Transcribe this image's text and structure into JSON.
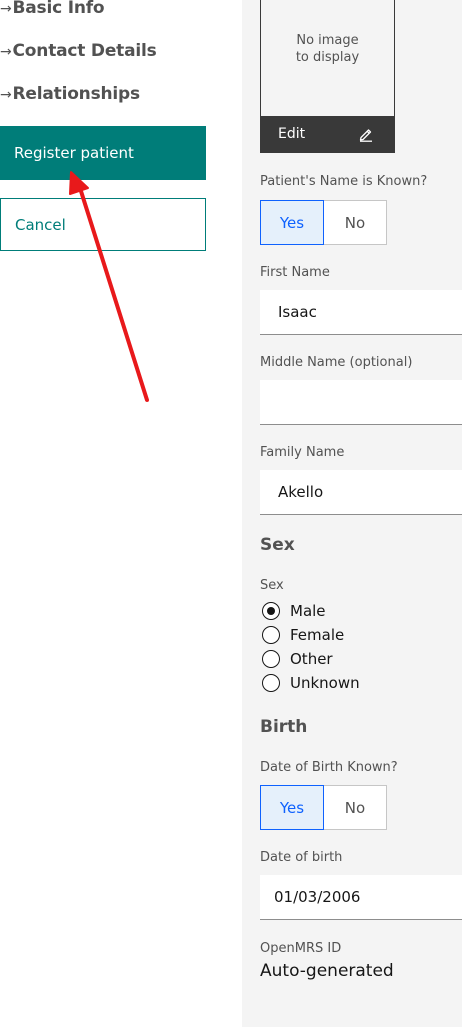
{
  "nav": {
    "items": [
      {
        "arrow": "→",
        "label": "Basic Info"
      },
      {
        "arrow": "→",
        "label": "Contact Details"
      },
      {
        "arrow": "→",
        "label": "Relationships"
      }
    ],
    "register_label": "Register patient",
    "cancel_label": "Cancel"
  },
  "photo": {
    "line1": "No image",
    "line2": "to display",
    "edit_label": "Edit"
  },
  "name_known": {
    "label": "Patient's Name is Known?",
    "yes": "Yes",
    "no": "No",
    "selected": "Yes"
  },
  "first_name": {
    "label": "First Name",
    "value": "Isaac"
  },
  "middle_name": {
    "label": "Middle Name (optional)",
    "value": ""
  },
  "family_name": {
    "label": "Family Name",
    "value": "Akello"
  },
  "sex": {
    "section_title": "Sex",
    "label": "Sex",
    "options": [
      "Male",
      "Female",
      "Other",
      "Unknown"
    ],
    "selected": "Male"
  },
  "birth": {
    "section_title": "Birth",
    "dob_known_label": "Date of Birth Known?",
    "yes": "Yes",
    "no": "No",
    "selected": "Yes",
    "dob_label": "Date of birth",
    "dob_value": "01/03/2006"
  },
  "identifier": {
    "label": "OpenMRS ID",
    "value": "Auto-generated"
  },
  "colors": {
    "primary": "#007d79",
    "selected_toggle": "#0f62fe",
    "annotation_arrow": "#e8191b",
    "form_bg": "#f4f4f4"
  },
  "icons": {
    "edit": "pencil-icon",
    "radio_checked": "radio-checked-icon",
    "radio_unchecked": "radio-unchecked-icon"
  }
}
